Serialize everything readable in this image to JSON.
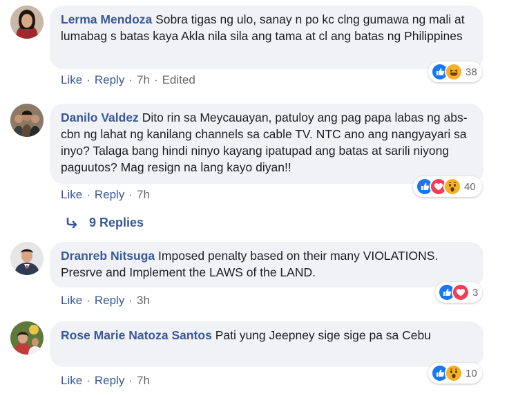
{
  "comments": [
    {
      "author": "Lerma Mendoza",
      "text": "Sobra tigas ng ulo, sanay n po kc clng gumawa ng mali at lumabag s batas kaya Akla nila sila ang tama at cl ang batas ng Philippines",
      "reactions": [
        "like-icon",
        "haha-icon"
      ],
      "reaction_count": "38",
      "like_label": "Like",
      "reply_label": "Reply",
      "time": "7h",
      "edited_label": "Edited"
    },
    {
      "author": "Danilo Valdez",
      "text": "Dito rin sa Meycauayan, patuloy ang pag papa labas ng abs-cbn ng lahat ng kanilang channels sa cable TV. NTC ano ang nangyayari sa inyo? Talaga bang hindi ninyo kayang ipatupad ang batas at sarili niyong paguutos? Mag resign na lang kayo diyan!!",
      "reactions": [
        "like-icon",
        "love-icon",
        "wow-icon"
      ],
      "reaction_count": "40",
      "like_label": "Like",
      "reply_label": "Reply",
      "time": "7h",
      "replies_label": "9 Replies"
    },
    {
      "author": "Dranreb Nitsuga",
      "text": "Imposed penalty based on their many VIOLATIONS. Presrve and Implement the LAWS of the LAND.",
      "reactions": [
        "like-icon",
        "love-icon"
      ],
      "reaction_count": "3",
      "like_label": "Like",
      "reply_label": "Reply",
      "time": "3h"
    },
    {
      "author": "Rose Marie Natoza Santos",
      "text": "Pati yung Jeepney sige sige pa sa Cebu",
      "reactions": [
        "like-icon",
        "wow-icon"
      ],
      "reaction_count": "10",
      "like_label": "Like",
      "reply_label": "Reply",
      "time": "7h"
    }
  ],
  "colors": {
    "link": "#385898",
    "bubble": "#f0f2f5",
    "like": "#1877f2",
    "love": "#f33e58",
    "haha": "#f7b125",
    "muted": "#65676b"
  }
}
